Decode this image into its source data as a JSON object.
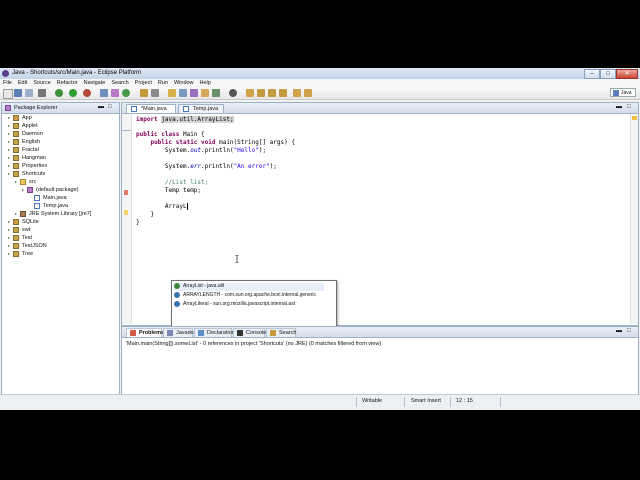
{
  "window": {
    "title": "Java - Shortcuts/src/Main.java - Eclipse Platform",
    "minimize": "–",
    "maximize": "□",
    "close": "✕"
  },
  "menu": [
    "File",
    "Edit",
    "Source",
    "Refactor",
    "Navigate",
    "Search",
    "Project",
    "Run",
    "Window",
    "Help"
  ],
  "perspective": {
    "label": "Java"
  },
  "package_explorer": {
    "title": "Package Explorer",
    "tree": [
      {
        "label": "App",
        "depth": 0,
        "icon": "project-icon"
      },
      {
        "label": "Applet",
        "depth": 0,
        "icon": "project-icon"
      },
      {
        "label": "Daemon",
        "depth": 0,
        "icon": "project-icon"
      },
      {
        "label": "English",
        "depth": 0,
        "icon": "project-icon"
      },
      {
        "label": "Fractal",
        "depth": 0,
        "icon": "project-icon"
      },
      {
        "label": "Hangman",
        "depth": 0,
        "icon": "project-icon"
      },
      {
        "label": "Properties",
        "depth": 0,
        "icon": "project-icon"
      },
      {
        "label": "Shortcuts",
        "depth": 0,
        "icon": "project-icon"
      },
      {
        "label": "src",
        "depth": 1,
        "icon": "folder-icon"
      },
      {
        "label": "(default package)",
        "depth": 2,
        "icon": "package-icon"
      },
      {
        "label": "Main.java",
        "depth": 3,
        "icon": "java-file-icon"
      },
      {
        "label": "Temp.java",
        "depth": 3,
        "icon": "java-file-icon"
      },
      {
        "label": "JRE System Library [jre7]",
        "depth": 1,
        "icon": "library-icon"
      },
      {
        "label": "SQLite",
        "depth": 0,
        "icon": "project-icon"
      },
      {
        "label": "swt",
        "depth": 0,
        "icon": "project-icon"
      },
      {
        "label": "Test",
        "depth": 0,
        "icon": "project-icon"
      },
      {
        "label": "TestJSON",
        "depth": 0,
        "icon": "project-icon"
      },
      {
        "label": "Tree",
        "depth": 0,
        "icon": "project-icon"
      }
    ]
  },
  "editor": {
    "tabs": [
      {
        "label": "*Main.java",
        "active": true
      },
      {
        "label": "Temp.java",
        "active": false
      }
    ],
    "code": {
      "import_kw": "import",
      "import_path": "java.util.ArrayList;",
      "class_kw": "public class",
      "class_rest": " Main {",
      "method_kw": "public static void",
      "method_rest": " main(String[] args) {",
      "print1_pre": "System.",
      "print1_field": "out",
      "print1_call": ".println(",
      "print1_str": "\"Hello\"",
      "print1_end": ");",
      "print2_pre": "System.",
      "print2_field": "err",
      "print2_call": ".println(",
      "print2_str": "\"An error\"",
      "print2_end": ");",
      "comment": "//List list;",
      "temp": "Temp temp;",
      "typing": "ArrayL",
      "brace1": "}",
      "brace2": "}"
    }
  },
  "content_assist": {
    "proposals": [
      {
        "label": "ArrayList - java.util",
        "color": "#3a8a3a"
      },
      {
        "label": "ARRAYLENGTH - com.sun.org.apache.bcel.internal.generic",
        "color": "#3a6fb0"
      },
      {
        "label": "ArrayLiteral - sun.org.mozilla.javascript.internal.ast",
        "color": "#3a6fb0"
      }
    ],
    "status": "Press 'Ctrl+Space' to show Template Proposals"
  },
  "bottom_panel": {
    "tabs": [
      {
        "label": "Problems",
        "active": true
      },
      {
        "label": "Javadoc",
        "active": false
      },
      {
        "label": "Declaration",
        "active": false
      },
      {
        "label": "Console",
        "active": false
      },
      {
        "label": "Search",
        "active": false
      }
    ],
    "message": "'Main.main(String[]).someList' - 0 references in project 'Shortcuts' (no JRE) (0 matches filtered from view)"
  },
  "status_bar": {
    "writable": "Writable",
    "insert_mode": "Smart Insert",
    "position": "12 : 15"
  }
}
